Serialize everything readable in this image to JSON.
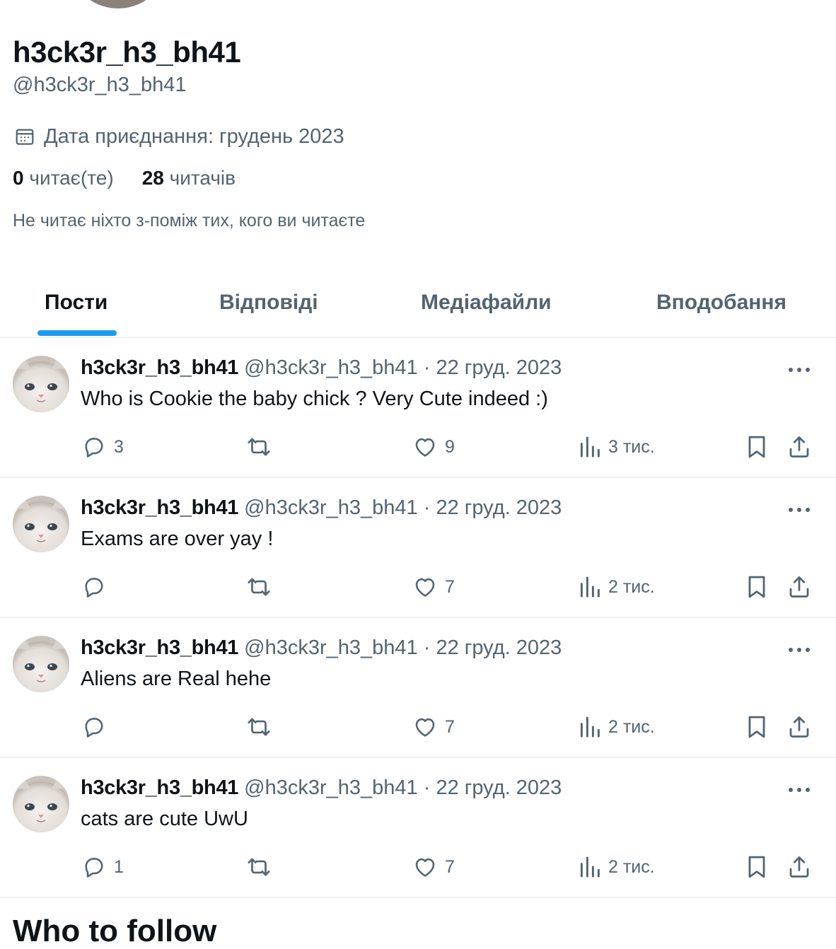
{
  "profile": {
    "display_name": "h3ck3r_h3_bh41",
    "handle": "@h3ck3r_h3_bh41",
    "joined": "Дата приєднання: грудень 2023",
    "following_count": "0",
    "following_label": " читає(те)",
    "followers_count": "28",
    "followers_label": " читачів",
    "mutual_note": "Не читає ніхто з-поміж тих, кого ви читаєте"
  },
  "tabs": [
    {
      "label": "Пости",
      "active": true
    },
    {
      "label": "Відповіді",
      "active": false
    },
    {
      "label": "Медіафайли",
      "active": false
    },
    {
      "label": "Вподобання",
      "active": false
    }
  ],
  "colors": {
    "accent": "#1d9bf0",
    "text_primary": "#0f1419",
    "text_secondary": "#536471",
    "divider": "#eff3f4"
  },
  "icons": {
    "join_date": "calendar-icon",
    "more": "more-dots-icon",
    "reply": "reply-icon",
    "repost": "repost-icon",
    "like": "like-icon",
    "views": "views-icon",
    "bookmark": "bookmark-icon",
    "share": "share-icon"
  },
  "posts": [
    {
      "name": "h3ck3r_h3_bh41",
      "handle": "@h3ck3r_h3_bh41",
      "separator": " · ",
      "date": "22 груд. 2023",
      "text": "Who is Cookie the baby chick ? Very Cute indeed :)",
      "replies": "3",
      "reposts": "",
      "likes": "9",
      "views": "3 тис."
    },
    {
      "name": "h3ck3r_h3_bh41",
      "handle": "@h3ck3r_h3_bh41",
      "separator": " · ",
      "date": "22 груд. 2023",
      "text": "Exams are over yay !",
      "replies": "",
      "reposts": "",
      "likes": "7",
      "views": "2 тис."
    },
    {
      "name": "h3ck3r_h3_bh41",
      "handle": "@h3ck3r_h3_bh41",
      "separator": " · ",
      "date": "22 груд. 2023",
      "text": "Aliens are Real hehe",
      "replies": "",
      "reposts": "",
      "likes": "7",
      "views": "2 тис."
    },
    {
      "name": "h3ck3r_h3_bh41",
      "handle": "@h3ck3r_h3_bh41",
      "separator": " · ",
      "date": "22 груд. 2023",
      "text": "cats are cute UwU",
      "replies": "1",
      "reposts": "",
      "likes": "7",
      "views": "2 тис."
    }
  ],
  "next_section_title": "Who to follow"
}
